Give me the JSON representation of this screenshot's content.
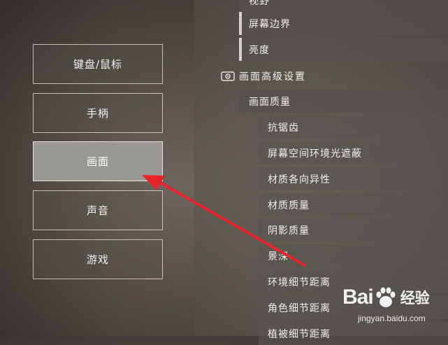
{
  "left_menu": {
    "items": [
      {
        "label": "键盘/鼠标",
        "active": false
      },
      {
        "label": "手柄",
        "active": false
      },
      {
        "label": "画面",
        "active": true
      },
      {
        "label": "声音",
        "active": false
      },
      {
        "label": "游戏",
        "active": false
      }
    ]
  },
  "settings": {
    "basic": {
      "partial_top": "视野",
      "screen_border": "屏幕边界",
      "brightness": "亮度"
    },
    "advanced_section": {
      "title": "画面高级设置",
      "icon": "advanced-settings-icon"
    },
    "quality_group": {
      "title": "画面质量",
      "items": [
        "抗锯齿",
        "屏幕空间环境光遮蔽",
        "材质各向异性",
        "材质质量",
        "阴影质量",
        "景深",
        "环境细节距离",
        "角色细节距离",
        "植被细节距离"
      ]
    }
  },
  "watermark": {
    "logo_text_left": "Bai",
    "logo_text_right": "经验",
    "url": "jingyan.baidu.com"
  },
  "colors": {
    "annotation_arrow": "#e8242a",
    "active_button_bg": "#9a9893"
  }
}
